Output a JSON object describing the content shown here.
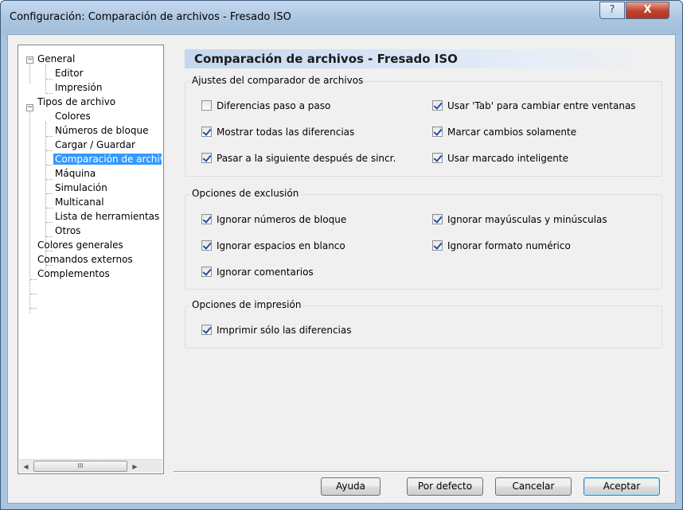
{
  "window": {
    "title": "Configuración: Comparación de archivos - Fresado ISO"
  },
  "titlebar": {
    "help_glyph": "?",
    "close_glyph": "X"
  },
  "tree": {
    "items": [
      {
        "label": "General",
        "expander": "−"
      },
      {
        "label": "Editor"
      },
      {
        "label": "Impresión"
      },
      {
        "label": "Tipos de archivo",
        "expander": "−"
      },
      {
        "label": "Colores"
      },
      {
        "label": "Números de bloque"
      },
      {
        "label": "Cargar / Guardar"
      },
      {
        "label": "Comparación de archivos",
        "selected": true
      },
      {
        "label": "Máquina"
      },
      {
        "label": "Simulación"
      },
      {
        "label": "Multicanal"
      },
      {
        "label": "Lista de herramientas"
      },
      {
        "label": "Otros"
      },
      {
        "label": "Colores generales"
      },
      {
        "label": "Comandos externos"
      },
      {
        "label": "Complementos"
      }
    ],
    "scroll_left_glyph": "◀",
    "scroll_right_glyph": "▶",
    "scroll_thumb_grip": "III"
  },
  "panel": {
    "title": "Comparación de archivos - Fresado ISO",
    "groups": [
      {
        "title": "Ajustes del comparador de archivos",
        "options": [
          {
            "label": "Diferencias paso a paso",
            "checked": false
          },
          {
            "label": "Usar 'Tab' para cambiar entre ventanas",
            "checked": true
          },
          {
            "label": "Mostrar todas las diferencias",
            "checked": true
          },
          {
            "label": "Marcar cambios solamente",
            "checked": true
          },
          {
            "label": "Pasar a la siguiente después de sincr.",
            "checked": true
          },
          {
            "label": "Usar marcado inteligente",
            "checked": true
          }
        ]
      },
      {
        "title": "Opciones de exclusión",
        "options": [
          {
            "label": "Ignorar números de bloque",
            "checked": true
          },
          {
            "label": "Ignorar mayúsculas y minúsculas",
            "checked": true
          },
          {
            "label": "Ignorar espacios en blanco",
            "checked": true
          },
          {
            "label": "Ignorar formato numérico",
            "checked": true
          },
          {
            "label": "Ignorar comentarios",
            "checked": true
          }
        ]
      },
      {
        "title": "Opciones de impresión",
        "options": [
          {
            "label": "Imprimir sólo las diferencias",
            "checked": true
          }
        ]
      }
    ]
  },
  "buttons": {
    "help": "Ayuda",
    "defaults": "Por defecto",
    "cancel": "Cancelar",
    "accept": "Aceptar"
  },
  "colors": {
    "selection": "#3399ff",
    "header_gradient_start": "#c4d7ee",
    "window_frame": "#a9c4de",
    "close_button": "#c0412b"
  }
}
